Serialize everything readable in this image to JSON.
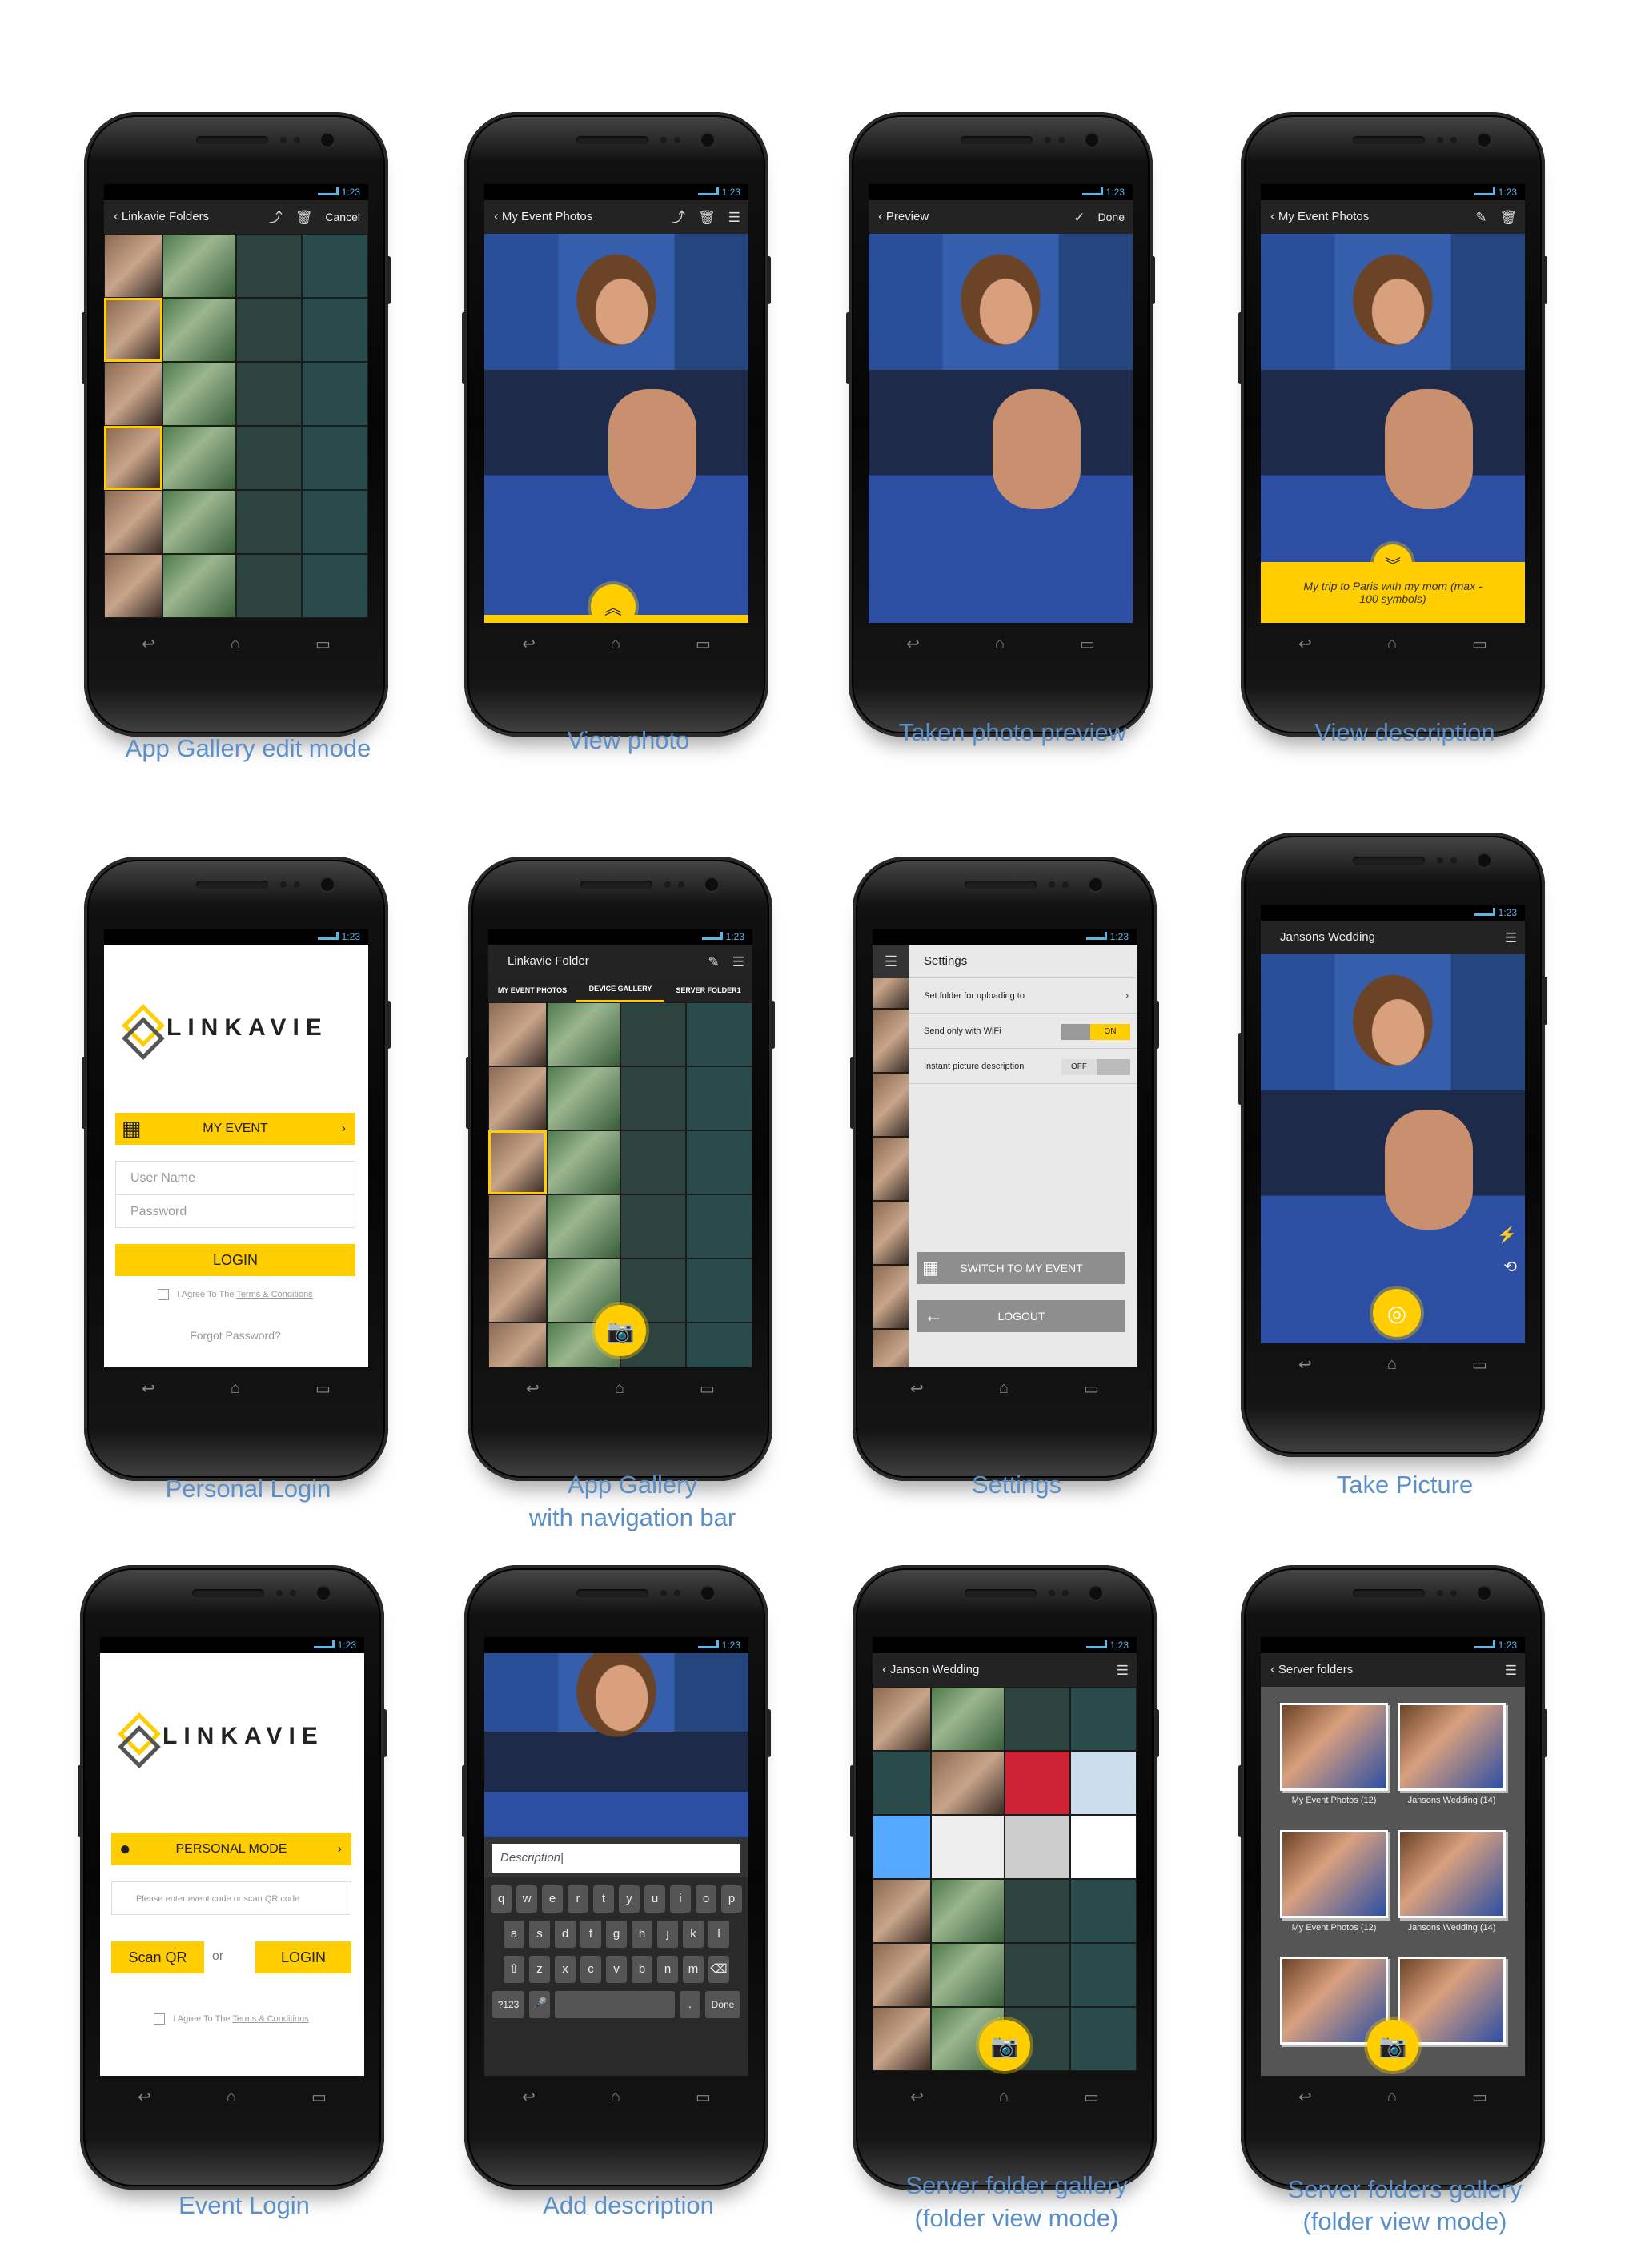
{
  "status_time": "1:23",
  "labels": {
    "l1": "App Gallery edit mode",
    "l2": "View photo",
    "l3": "Taken photo preview",
    "l4": "View description",
    "l5": "Personal Login",
    "l6a": "App Gallery",
    "l6b": "with navigation bar",
    "l7": "Settings",
    "l8": "Take Picture",
    "l9": "Event Login",
    "l10": "Add description",
    "l11a": "Server folder gallery",
    "l11b": "(folder view mode)",
    "l12a": "Server folders gallery",
    "l12b": "(folder view mode)"
  },
  "s1": {
    "title": "Linkavie Folders",
    "cancel": "Cancel"
  },
  "s2": {
    "title": "My Event Photos"
  },
  "s3": {
    "title": "Preview",
    "done": "Done"
  },
  "s4": {
    "title": "My Event Photos",
    "desc": "My trip to Paris with my mom (max - 100 symbols)"
  },
  "s5": {
    "logo": "LINKAVIE",
    "event": "MY EVENT",
    "user": "User Name",
    "pass": "Password",
    "login": "LOGIN",
    "agree": "I Agree To The",
    "terms": "Terms & Conditions",
    "forgot": "Forgot Password?"
  },
  "s6": {
    "title": "Linkavie Folder",
    "tabs": [
      "MY EVENT PHOTOS",
      "DEVICE GALLERY",
      "SERVER FOLDER1"
    ]
  },
  "s7": {
    "title": "Settings",
    "rows": [
      "Set folder for uploading to",
      "Send only with WiFi",
      "Instant picture description"
    ],
    "on": "ON",
    "off": "OFF",
    "switch": "SWITCH TO MY EVENT",
    "logout": "LOGOUT"
  },
  "s8": {
    "title": "Jansons Wedding"
  },
  "s9": {
    "logo": "LINKAVIE",
    "mode": "PERSONAL MODE",
    "code": "Please enter event code  or scan  QR code",
    "scan": "Scan  QR",
    "or": "or",
    "login": "LOGIN",
    "agree": "I Agree To The",
    "terms": "Terms & Conditions"
  },
  "s10": {
    "placeholder": "Description|",
    "keys1": [
      "q",
      "w",
      "e",
      "r",
      "t",
      "y",
      "u",
      "i",
      "o",
      "p"
    ],
    "keys2": [
      "a",
      "s",
      "d",
      "f",
      "g",
      "h",
      "j",
      "k",
      "l"
    ],
    "keys3": [
      "z",
      "x",
      "c",
      "v",
      "b",
      "n",
      "m"
    ],
    "sym": "?123",
    "done": "Done"
  },
  "s11": {
    "title": "Janson Wedding"
  },
  "s12": {
    "title": "Server folders",
    "captions": [
      "My Event Photos (12)",
      "Jansons Wedding (14)",
      "My Event Photos (12)",
      "Jansons Wedding (14)"
    ]
  }
}
